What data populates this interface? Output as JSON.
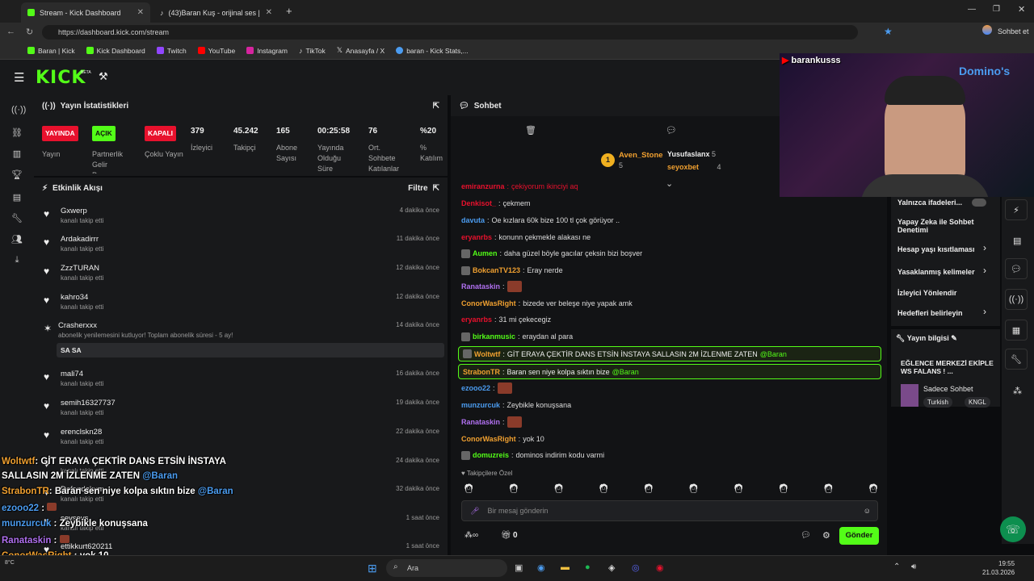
{
  "browser": {
    "tabs": [
      {
        "title": "Stream - Kick Dashboard"
      },
      {
        "title": "(43)Baran Kuş - orijinal ses | TikTok"
      }
    ],
    "url": "https://dashboard.kick.com/stream",
    "profile_label": "Sohbet et",
    "bookmarks": [
      "Baran | Kick",
      "Kick Dashboard",
      "Twitch",
      "YouTube",
      "Instagram",
      "TikTok",
      "Anasayfa / X",
      "baran - Kick Stats,..."
    ]
  },
  "app": {
    "logo": "KICK",
    "beta": "BETA"
  },
  "stats": {
    "title": "Yayın İstatistikleri",
    "items": [
      {
        "badge": "YAYINDA",
        "label": "Yayın",
        "color": "#e8112d"
      },
      {
        "badge": "AÇIK",
        "label": "Partnerlik Gelir Programı",
        "color": "#53fc18"
      },
      {
        "badge": "KAPALI",
        "label": "Çoklu Yayın",
        "color": "#e8112d"
      },
      {
        "value": "379",
        "label": "İzleyici"
      },
      {
        "value": "45.242",
        "label": "Takipçi"
      },
      {
        "value": "165",
        "label": "Abone Sayısı"
      },
      {
        "value": "00:25:58",
        "label": "Yayında Olduğu Süre"
      },
      {
        "value": "76",
        "label": "Ort. Sohbete Katılanlar"
      },
      {
        "value": "%20",
        "label": "% Katılım"
      }
    ]
  },
  "activity": {
    "title": "Etkinlik Akışı",
    "filter": "Filtre",
    "items": [
      {
        "user": "Gxwerp",
        "sub": "kanalı takip etti",
        "time": "4 dakika önce"
      },
      {
        "user": "Ardakadirrr",
        "sub": "kanalı takip etti",
        "time": "11 dakika önce"
      },
      {
        "user": "ZzzTURAN",
        "sub": "kanalı takip etti",
        "time": "12 dakika önce"
      },
      {
        "user": "kahro34",
        "sub": "kanalı takip etti",
        "time": "12 dakika önce"
      },
      {
        "user": "Crasherxxx",
        "sub": "abonelik yenilemesini kutluyor! Toplam abonelik süresi - 5 ay!",
        "time": "14 dakika önce",
        "msg": "SA SA"
      },
      {
        "user": "mali74",
        "sub": "kanalı takip etti",
        "time": "16 dakika önce"
      },
      {
        "user": "semih16327737",
        "sub": "kanalı takip etti",
        "time": "19 dakika önce"
      },
      {
        "user": "erenclskn28",
        "sub": "kanalı takip etti",
        "time": "22 dakika önce"
      },
      {
        "user": "",
        "sub": "kanalı takip etti",
        "time": "24 dakika önce"
      },
      {
        "user": "Defondokum",
        "sub": "kanalı takip etti",
        "time": "32 dakika önce"
      },
      {
        "user": "sevsevs",
        "sub": "kanalı takip etti",
        "time": "1 saat önce"
      },
      {
        "user": "ettikkurt620211",
        "sub": "",
        "time": "1 saat önce"
      }
    ]
  },
  "chat": {
    "title": "Sohbet",
    "leaders": [
      {
        "rank": "1",
        "name": "Aven_Stone",
        "count": "5"
      },
      {
        "name": "Yusufaslanx",
        "count": "5"
      },
      {
        "name": "seyoxbet",
        "count": "4"
      }
    ],
    "messages": [
      {
        "user": "emiranzurna",
        "text": "çekiyorum ikinciyi aq",
        "color": "#e8112d"
      },
      {
        "user": "Denkisot_",
        "text": "çekmem",
        "color": "#e8112d"
      },
      {
        "user": "davuta",
        "text": "Oe kızlara 60k bize 100 tl çok görüyor ..",
        "color": "#4b9cf0"
      },
      {
        "user": "eryanrbs",
        "text": "konunn çekmekle alakası ne",
        "color": "#e8112d"
      },
      {
        "user": "Aumen",
        "text": "daha güzel böyle gacılar çeksin bizi boşver",
        "color": "#53fc18"
      },
      {
        "user": "BokcanTV123",
        "text": "Eray nerde",
        "color": "#f0a030"
      },
      {
        "user": "Ranataskin",
        "text": "",
        "color": "#b070f0"
      },
      {
        "user": "ConorWasRight",
        "text": "bizede ver beleşe niye yapak amk",
        "color": "#f0a030"
      },
      {
        "user": "eryanrbs",
        "text": "31 mi çekecegiz",
        "color": "#e8112d"
      },
      {
        "user": "birkanmusic",
        "text": "eraydan al para",
        "color": "#53fc18"
      },
      {
        "user": "Woltwtf",
        "text": "GİT ERAYA ÇEKTİR DANS ETSİN İNSTAYA SALLASIN 2M İZLENME ZATEN",
        "mention": "@Baran",
        "color": "#f0a030",
        "highlight": true
      },
      {
        "user": "StrabonTR",
        "text": "Baran sen niye kolpa sıktın bize",
        "mention": "@Baran",
        "color": "#f0a030",
        "highlight": true
      },
      {
        "user": "ezooo22",
        "text": "",
        "color": "#4b9cf0"
      },
      {
        "user": "munzurcuk",
        "text": "Zeybikle konuşsana",
        "color": "#4b9cf0"
      },
      {
        "user": "Ranataskin",
        "text": "",
        "color": "#b070f0"
      },
      {
        "user": "ConorWasRight",
        "text": "yok 10",
        "color": "#f0a030"
      },
      {
        "user": "domuzreis",
        "text": "dominos indirim kodu varmi",
        "color": "#53fc18"
      }
    ],
    "followers_only": "Takipçilere Özel",
    "input_placeholder": "Bir mesaj gönderin",
    "points": "0",
    "send": "Gönder"
  },
  "right": {
    "options": [
      "Yalnızca ifadeleri...",
      "Yapay Zeka ile Sohbet Denetimi",
      "Hesap yaşı kısıtlaması",
      "Yasaklanmış kelimeler",
      "İzleyici Yönlendir",
      "Hedefleri belirleyin"
    ],
    "info_title": "Yayın bilgisi",
    "stream_title": "EĞLENCE MERKEZİ EKİPLE WS FALANS ! ...",
    "category": "Sadece Sohbet",
    "tags": [
      "Turkish",
      "KNGL"
    ]
  },
  "webcam": {
    "channel": "barankusss",
    "sponsor": "Domino's"
  },
  "overlay": [
    {
      "user": "Woltwtf",
      "text": "GİT ERAYA ÇEKTİR DANS ETSİN İNSTAYA",
      "color": "#f0a030"
    },
    {
      "user": "",
      "text": "SALLASIN 2M İZLENME ZATEN",
      "mention": "@Baran",
      "color": "#fff"
    },
    {
      "user": "StrabonTR",
      "text": "Baran sen niye kolpa sıktın bize",
      "mention": "@Baran",
      "color": "#f0a030"
    },
    {
      "user": "ezooo22",
      "text": "",
      "color": "#4b9cf0"
    },
    {
      "user": "munzurcuk",
      "text": "Zeybikle konuşsana",
      "color": "#4b9cf0"
    },
    {
      "user": "Ranataskin",
      "text": "",
      "color": "#b070f0"
    },
    {
      "user": "ConorWasRight",
      "text": "yok 10",
      "color": "#f0a030"
    },
    {
      "user": "domuzreis",
      "text": "dominos indirim kodu varmi",
      "color": "#53fc18"
    }
  ],
  "taskbar": {
    "search": "Ara",
    "time": "19:55",
    "date": "21.03.2026",
    "temp": "8°C"
  }
}
